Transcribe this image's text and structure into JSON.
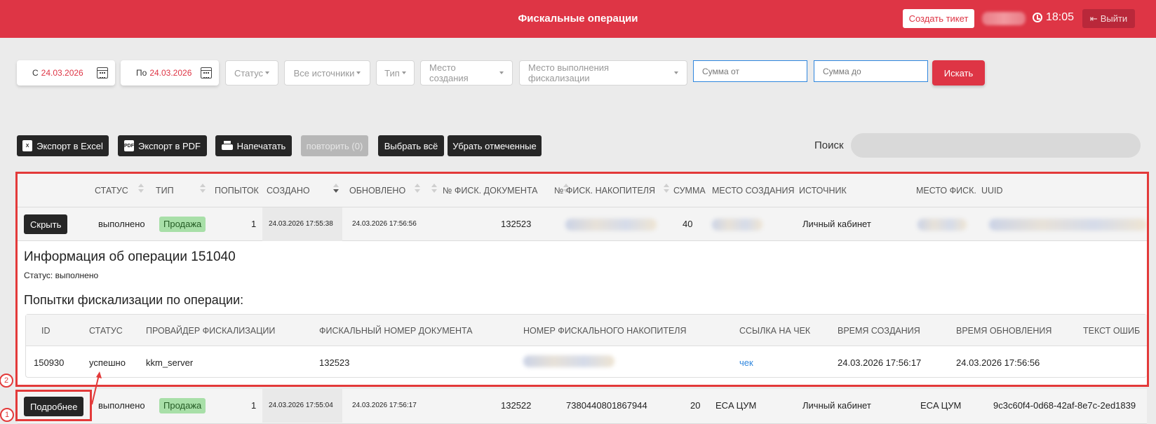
{
  "header": {
    "title": "Фискальные операции",
    "create_ticket": "Создать тикет",
    "time": "18:05",
    "logout": "Выйти"
  },
  "filters": {
    "from_label": "С",
    "from_value": "24.03.2026",
    "to_label": "По",
    "to_value": "24.03.2026",
    "status": "Статус",
    "sources": "Все источники",
    "type": "Тип",
    "creation_place": "Место создания",
    "fiscal_place": "Место выполнения фискализации",
    "sum_from_placeholder": "Сумма от",
    "sum_to_placeholder": "Сумма до",
    "search_button": "Искать"
  },
  "toolbar": {
    "excel_icon": "X",
    "pdf_icon": "PDF",
    "export_excel": "Экспорт в Excel",
    "export_pdf": "Экспорт в PDF",
    "print": "Напечатать",
    "repeat": "повторить (0)",
    "select_all": "Выбрать всё",
    "unselect": "Убрать отмеченные",
    "search_label": "Поиск"
  },
  "table": {
    "headers": {
      "status": "СТАТУС",
      "type": "ТИП",
      "attempts": "ПОПЫТОК",
      "created": "СОЗДАНО",
      "updated": "ОБНОВЛЕНО",
      "fisc_doc": "№ ФИСК. ДОКУМЕНТА",
      "fisc_storage": "№ ФИСК. НАКОПИТЕЛЯ",
      "sum": "СУММА",
      "creation_place": "МЕСТО СОЗДАНИЯ",
      "source": "ИСТОЧНИК",
      "fisc_place": "МЕСТО ФИСК.",
      "uuid": "UUID"
    },
    "rows": [
      {
        "button": "Скрыть",
        "status": "выполнено",
        "type": "Продажа",
        "attempts": "1",
        "created": "24.03.2026 17:55:38",
        "updated": "24.03.2026 17:56:56",
        "fisc_doc": "132523",
        "sum": "40",
        "source": "Личный кабинет"
      },
      {
        "button": "Подробнее",
        "status": "выполнено",
        "type": "Продажа",
        "attempts": "1",
        "created": "24.03.2026 17:55:04",
        "updated": "24.03.2026 17:56:17",
        "fisc_doc": "132522",
        "fisc_storage": "7380440801867944",
        "sum": "20",
        "creation_place": "ECA ЦУМ",
        "source": "Личный кабинет",
        "fisc_place": "ECA ЦУМ",
        "uuid": "9c3c60f4-0d68-42af-8e7c-2ed1839"
      }
    ]
  },
  "detail": {
    "title": "Информация об операции 151040",
    "status_line": "Статус: выполнено",
    "attempts_title": "Попытки фискализации по операции:",
    "headers": {
      "id": "ID",
      "status": "СТАТУС",
      "provider": "ПРОВАЙДЕР ФИСКАЛИЗАЦИИ",
      "doc_number": "ФИСКАЛЬНЫЙ НОМЕР ДОКУМЕНТА",
      "storage_number": "НОМЕР ФИСКАЛЬНОГО НАКОПИТЕЛЯ",
      "receipt_link": "ССЫЛКА НА ЧЕК",
      "created": "ВРЕМЯ СОЗДАНИЯ",
      "updated": "ВРЕМЯ ОБНОВЛЕНИЯ",
      "error_text": "ТЕКСТ ОШИБ"
    },
    "row": {
      "id": "150930",
      "status": "успешно",
      "provider": "kkm_server",
      "doc_number": "132523",
      "receipt_link": "чек",
      "created": "24.03.2026 17:56:17",
      "updated": "24.03.2026 17:56:56"
    }
  },
  "annotations": {
    "marker1": "1",
    "marker2": "2",
    "color": "#e33a3a"
  }
}
